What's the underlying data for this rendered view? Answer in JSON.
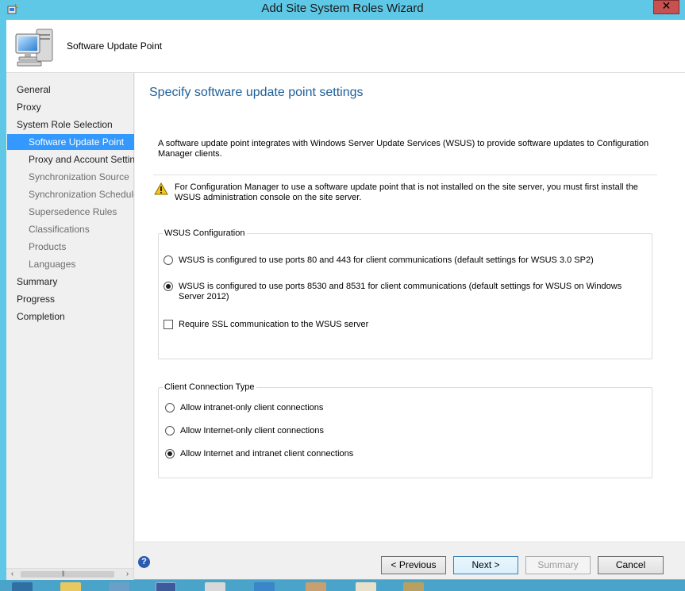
{
  "window": {
    "title": "Add Site System Roles Wizard",
    "close_glyph": "✕"
  },
  "header": {
    "title": "Software Update Point",
    "icon": "computer-icon"
  },
  "nav": {
    "items": [
      {
        "label": "General"
      },
      {
        "label": "Proxy"
      },
      {
        "label": "System Role Selection"
      },
      {
        "label": "Software Update Point",
        "active": true
      },
      {
        "label": "Proxy and Account Settings"
      },
      {
        "label": "Synchronization Source"
      },
      {
        "label": "Synchronization Schedule"
      },
      {
        "label": "Supersedence Rules"
      },
      {
        "label": "Classifications"
      },
      {
        "label": "Products"
      },
      {
        "label": "Languages"
      },
      {
        "label": "Summary"
      },
      {
        "label": "Progress"
      },
      {
        "label": "Completion"
      }
    ]
  },
  "main": {
    "page_title": "Specify software update point settings",
    "description": "A software update point integrates with Windows Server Update Services (WSUS) to provide software updates to Configuration Manager clients.",
    "warning": "For Configuration Manager to use a software update point that is not installed on the site server, you must first install the WSUS administration console on the site server.",
    "wsus_group": {
      "legend": "WSUS Configuration",
      "option_80_443": "WSUS is configured to use ports 80 and 443 for client communications (default settings for WSUS 3.0 SP2)",
      "option_8530_8531": "WSUS is configured to use ports 8530 and 8531 for client communications (default settings for WSUS on Windows Server 2012)",
      "selected": "option_8530_8531",
      "ssl_label": "Require SSL communication to the WSUS server",
      "ssl_checked": false
    },
    "client_group": {
      "legend": "Client Connection Type",
      "intranet_only": "Allow intranet-only client connections",
      "internet_only": "Allow Internet-only client connections",
      "both": "Allow Internet and intranet client connections",
      "selected": "both"
    }
  },
  "footer": {
    "help_glyph": "?",
    "previous": "< Previous",
    "next": "Next >",
    "summary": "Summary",
    "cancel": "Cancel"
  },
  "colors": {
    "title_bar": "#5ec8e6",
    "selected_nav": "#3399ff",
    "page_title": "#1f5f99",
    "close_button": "#c75050"
  }
}
